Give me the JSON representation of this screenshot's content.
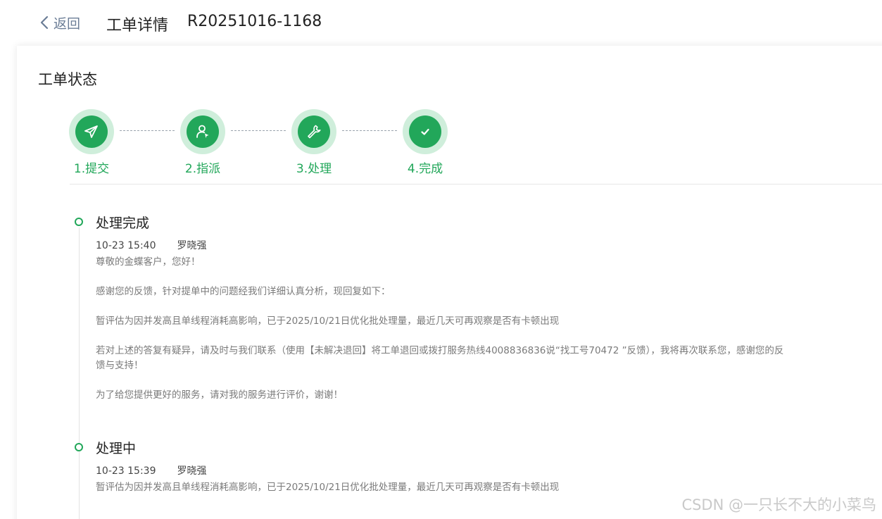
{
  "header": {
    "back_label": "返回",
    "title": "工单详情",
    "order_no": "R20251016-1168"
  },
  "status": {
    "section_title": "工单状态",
    "accent_color": "#22a75a",
    "steps": [
      {
        "label": "1.提交",
        "icon": "send-icon"
      },
      {
        "label": "2.指派",
        "icon": "assign-user-icon"
      },
      {
        "label": "3.处理",
        "icon": "wrench-icon"
      },
      {
        "label": "4.完成",
        "icon": "check-icon"
      }
    ]
  },
  "timeline": [
    {
      "title": "处理完成",
      "time": "10-23 15:40",
      "person": "罗晓强",
      "paragraphs": [
        "尊敬的金蝶客户，您好！",
        "感谢您的反馈，针对提单中的问题经我们详细认真分析，现回复如下：",
        "暂评估为因并发高且单线程消耗高影响，已于2025/10/21日优化批处理量，最近几天可再观察是否有卡顿出现",
        "若对上述的答复有疑异，请及时与我们联系（使用【未解决退回】将工单退回或拨打服务热线4008836836说“找工号70472 ”反馈），我将再次联系您，感谢您的反馈与支持！",
        "为了给您提供更好的服务，请对我的服务进行评价，谢谢！"
      ]
    },
    {
      "title": "处理中",
      "time": "10-23 15:39",
      "person": "罗晓强",
      "paragraphs": [
        "暂评估为因并发高且单线程消耗高影响，已于2025/10/21日优化批处理量，最近几天可再观察是否有卡顿出现"
      ]
    }
  ],
  "watermark": "CSDN @一只长不大的小菜鸟"
}
